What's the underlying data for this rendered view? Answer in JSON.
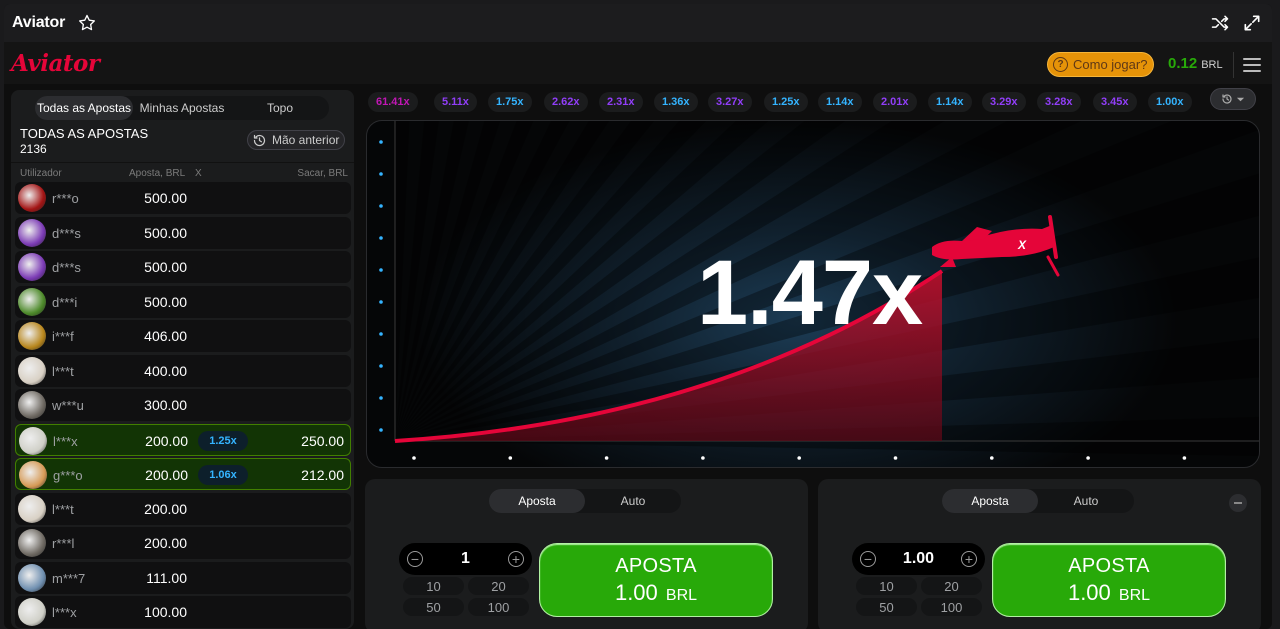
{
  "topbar": {
    "title": "Aviator"
  },
  "header": {
    "logo": "Aviator",
    "how_to_play": "Como jogar?",
    "balance": "0.12",
    "currency": "BRL",
    "colors": {
      "brand": "#e50539",
      "balance": "#28a909",
      "howto_bg": "#e69308"
    }
  },
  "bets_panel": {
    "tabs": [
      {
        "label": "Todas as Apostas",
        "active": true
      },
      {
        "label": "Minhas Apostas",
        "active": false
      },
      {
        "label": "Topo",
        "active": false
      }
    ],
    "title": "TODAS AS APOSTAS",
    "count": "2136",
    "previous_hand": "Mão anterior",
    "columns": {
      "user": "Utilizador",
      "bet": "Aposta, BRL",
      "x": "X",
      "cashout": "Sacar, BRL"
    },
    "rows": [
      {
        "user": "r***o",
        "bet": "500.00",
        "mult": "",
        "cashout": "",
        "win": false,
        "avatar": "#a31414"
      },
      {
        "user": "d***s",
        "bet": "500.00",
        "mult": "",
        "cashout": "",
        "win": false,
        "avatar": "#7b3ab5"
      },
      {
        "user": "d***s",
        "bet": "500.00",
        "mult": "",
        "cashout": "",
        "win": false,
        "avatar": "#7b3ab5"
      },
      {
        "user": "d***i",
        "bet": "500.00",
        "mult": "",
        "cashout": "",
        "win": false,
        "avatar": "#4d8a2a"
      },
      {
        "user": "i***f",
        "bet": "406.00",
        "mult": "",
        "cashout": "",
        "win": false,
        "avatar": "#b8861c"
      },
      {
        "user": "l***t",
        "bet": "400.00",
        "mult": "",
        "cashout": "",
        "win": false,
        "avatar": "#d8d0c4"
      },
      {
        "user": "w***u",
        "bet": "300.00",
        "mult": "",
        "cashout": "",
        "win": false,
        "avatar": "#6f6a63"
      },
      {
        "user": "l***x",
        "bet": "200.00",
        "mult": "1.25x",
        "cashout": "250.00",
        "win": true,
        "avatar": "#cfcfc7"
      },
      {
        "user": "g***o",
        "bet": "200.00",
        "mult": "1.06x",
        "cashout": "212.00",
        "win": true,
        "avatar": "#d69a56"
      },
      {
        "user": "l***t",
        "bet": "200.00",
        "mult": "",
        "cashout": "",
        "win": false,
        "avatar": "#d8d0c4"
      },
      {
        "user": "r***l",
        "bet": "200.00",
        "mult": "",
        "cashout": "",
        "win": false,
        "avatar": "#6f6a63"
      },
      {
        "user": "m***7",
        "bet": "111.00",
        "mult": "",
        "cashout": "",
        "win": false,
        "avatar": "#6f8fb0"
      },
      {
        "user": "l***x",
        "bet": "100.00",
        "mult": "",
        "cashout": "",
        "win": false,
        "avatar": "#cfcfc7"
      }
    ]
  },
  "history": [
    {
      "value": "61.41x",
      "color": "#c017b4"
    },
    {
      "value": "5.11x",
      "color": "#913ef8"
    },
    {
      "value": "1.75x",
      "color": "#34b4ff"
    },
    {
      "value": "2.62x",
      "color": "#913ef8"
    },
    {
      "value": "2.31x",
      "color": "#913ef8"
    },
    {
      "value": "1.36x",
      "color": "#34b4ff"
    },
    {
      "value": "3.27x",
      "color": "#913ef8"
    },
    {
      "value": "1.25x",
      "color": "#34b4ff"
    },
    {
      "value": "1.14x",
      "color": "#34b4ff"
    },
    {
      "value": "2.01x",
      "color": "#913ef8"
    },
    {
      "value": "1.14x",
      "color": "#34b4ff"
    },
    {
      "value": "3.29x",
      "color": "#913ef8"
    },
    {
      "value": "3.28x",
      "color": "#913ef8"
    },
    {
      "value": "3.45x",
      "color": "#913ef8"
    },
    {
      "value": "1.00x",
      "color": "#34b4ff"
    }
  ],
  "game": {
    "multiplier": "1.47x",
    "plane_color": "#e50539"
  },
  "bet_panels": [
    {
      "tabs": [
        {
          "label": "Aposta",
          "active": true
        },
        {
          "label": "Auto",
          "active": false
        }
      ],
      "amount": "1",
      "quick": [
        "10",
        "20",
        "50",
        "100"
      ],
      "button_label": "APOSTA",
      "button_amount": "1.00",
      "button_currency": "BRL"
    },
    {
      "tabs": [
        {
          "label": "Aposta",
          "active": true
        },
        {
          "label": "Auto",
          "active": false
        }
      ],
      "amount": "1.00",
      "quick": [
        "10",
        "20",
        "50",
        "100"
      ],
      "button_label": "APOSTA",
      "button_amount": "1.00",
      "button_currency": "BRL"
    }
  ]
}
